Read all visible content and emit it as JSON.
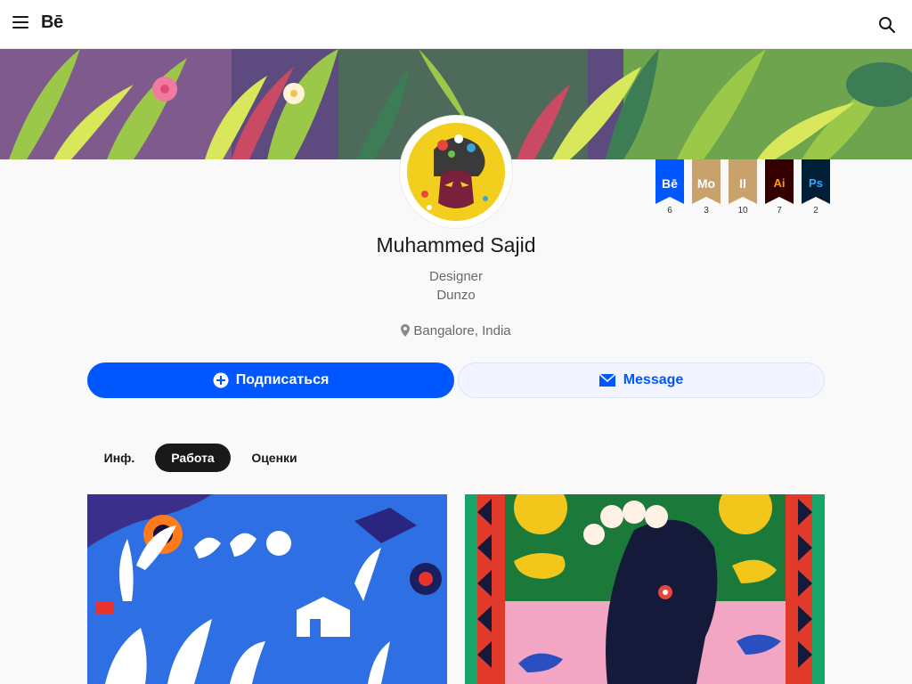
{
  "header": {
    "logo": "Bē",
    "menu_icon": "hamburger-menu-icon",
    "search_icon": "search-icon"
  },
  "profile": {
    "name": "Muhammed Sajid",
    "occupation": "Designer",
    "company": "Dunzo",
    "location": "Bangalore, India",
    "location_icon": "location-pin-icon"
  },
  "badges": [
    {
      "label": "Bē",
      "count": "6",
      "color": "#0057ff",
      "text_color": "#ffffff"
    },
    {
      "label": "Mo",
      "count": "3",
      "color": "#c8a26a",
      "text_color": "#ffffff"
    },
    {
      "label": "Il",
      "count": "10",
      "color": "#c8a26a",
      "text_color": "#ffffff"
    },
    {
      "label": "Ai",
      "count": "7",
      "color": "#330000",
      "text_color": "#ff9a00"
    },
    {
      "label": "Ps",
      "count": "2",
      "color": "#001e36",
      "text_color": "#31a8ff"
    }
  ],
  "actions": {
    "follow_label": "Подписаться",
    "follow_icon": "plus-circle-icon",
    "message_label": "Message",
    "message_icon": "envelope-icon"
  },
  "tabs": [
    {
      "label": "Инф.",
      "active": false
    },
    {
      "label": "Работа",
      "active": true
    },
    {
      "label": "Оценки",
      "active": false
    }
  ],
  "colors": {
    "accent": "#0057ff",
    "tab_active_bg": "#191919",
    "background": "#f9f9f9"
  }
}
